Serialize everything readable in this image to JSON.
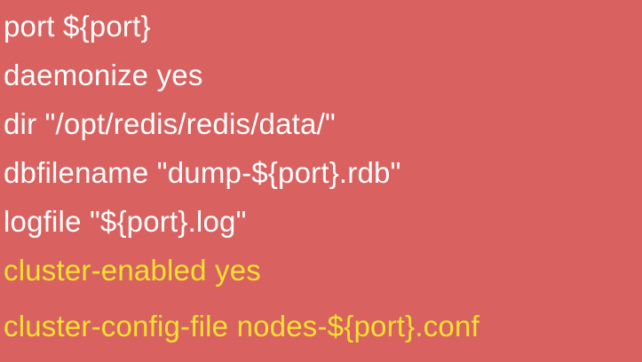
{
  "lines": [
    {
      "text": "port ${port}",
      "highlight": false
    },
    {
      "text": "daemonize yes",
      "highlight": false
    },
    {
      "text": "dir \"/opt/redis/redis/data/\"",
      "highlight": false
    },
    {
      "text": "dbfilename \"dump-${port}.rdb\"",
      "highlight": false
    },
    {
      "text": "logfile \"${port}.log\"",
      "highlight": false
    },
    {
      "text": "cluster-enabled yes",
      "highlight": true
    },
    {
      "text": "cluster-config-file nodes-${port}.conf",
      "highlight": true
    }
  ],
  "colors": {
    "background": "#d96160",
    "text": "#ffffff",
    "highlight": "#f5e22f"
  }
}
